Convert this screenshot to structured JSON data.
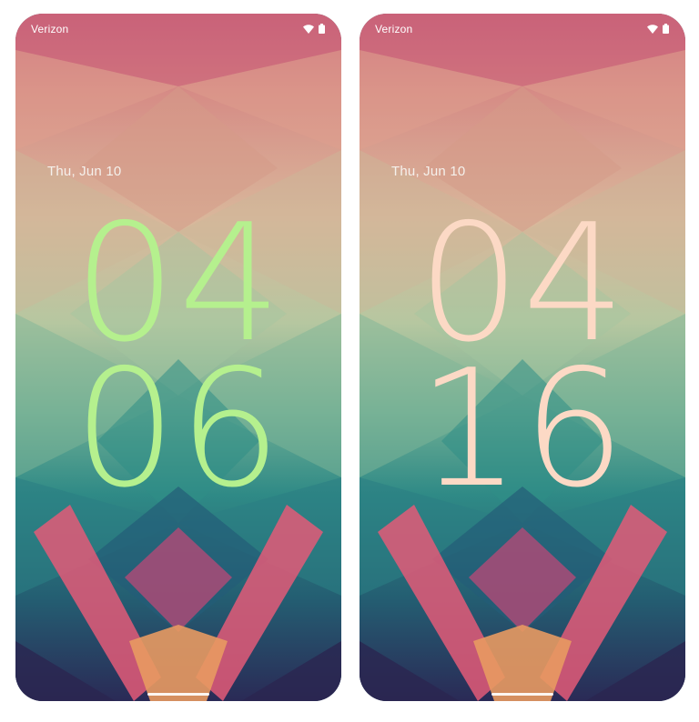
{
  "screens": [
    {
      "carrier": "Verizon",
      "date": "Thu, Jun 10",
      "hours": "04",
      "minutes": "06",
      "clock_color": "#b5f08e"
    },
    {
      "carrier": "Verizon",
      "date": "Thu, Jun 10",
      "hours": "04",
      "minutes": "16",
      "clock_color": "#fcd9c5"
    }
  ],
  "icons": {
    "wifi": "wifi-icon",
    "battery": "battery-icon"
  },
  "colors": {
    "background": "#ffffff",
    "status_text": "#ffffff",
    "date_text": "#f5f1ec"
  }
}
